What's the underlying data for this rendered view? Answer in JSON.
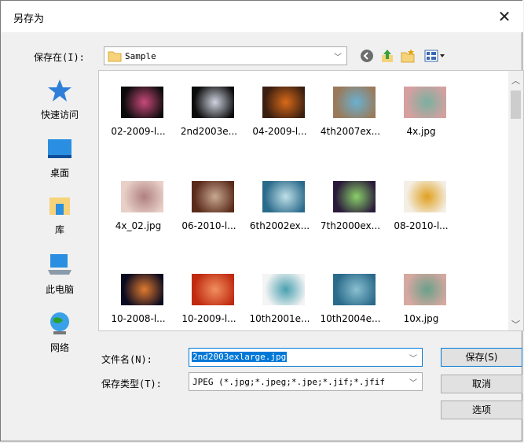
{
  "dialog": {
    "title": "另存为"
  },
  "toolbar": {
    "save_in_label": "保存在(I):",
    "current_folder": "Sample"
  },
  "places": [
    {
      "label": "快速访问",
      "icon": "star-icon"
    },
    {
      "label": "桌面",
      "icon": "desktop-icon"
    },
    {
      "label": "库",
      "icon": "library-icon"
    },
    {
      "label": "此电脑",
      "icon": "computer-icon"
    },
    {
      "label": "网络",
      "icon": "network-icon"
    }
  ],
  "files": [
    {
      "name": "02-2009-l...",
      "colors": [
        "#0b0b0b",
        "#c84a7a"
      ]
    },
    {
      "name": "2nd2003e...",
      "colors": [
        "#0b0b0b",
        "#cfd3e0"
      ]
    },
    {
      "name": "04-2009-l...",
      "colors": [
        "#3a1e10",
        "#d86a1a"
      ]
    },
    {
      "name": "4th2007ex...",
      "colors": [
        "#9a7a5a",
        "#6ab0d0"
      ]
    },
    {
      "name": "4x.jpg",
      "colors": [
        "#d6a0a0",
        "#7ab0a0"
      ]
    },
    {
      "name": "4x_02.jpg",
      "colors": [
        "#e8d0c8",
        "#b08080"
      ]
    },
    {
      "name": "06-2010-l...",
      "colors": [
        "#5a2a1a",
        "#c8a890"
      ]
    },
    {
      "name": "6th2002ex...",
      "colors": [
        "#2a6a8a",
        "#bfe0e8"
      ]
    },
    {
      "name": "7th2000ex...",
      "colors": [
        "#2a1a3a",
        "#8acf6a"
      ]
    },
    {
      "name": "08-2010-l...",
      "colors": [
        "#f4efe6",
        "#e0a020"
      ]
    },
    {
      "name": "10-2008-l...",
      "colors": [
        "#0a0a20",
        "#e07a30"
      ]
    },
    {
      "name": "10-2009-l...",
      "colors": [
        "#c02a10",
        "#f09060"
      ]
    },
    {
      "name": "10th2001e...",
      "colors": [
        "#f4f4f4",
        "#4aa0b0"
      ]
    },
    {
      "name": "10th2004e...",
      "colors": [
        "#2a6a8a",
        "#8ac0d0"
      ]
    },
    {
      "name": "10x.jpg",
      "colors": [
        "#d6a8a0",
        "#6aa08a"
      ]
    }
  ],
  "fields": {
    "filename_label": "文件名(N):",
    "filename_value": "2nd2003exlarge.jpg",
    "filetype_label": "保存类型(T):",
    "filetype_value": "JPEG (*.jpg;*.jpeg;*.jpe;*.jif;*.jfif"
  },
  "buttons": {
    "save": "保存(S)",
    "cancel": "取消",
    "options": "选项"
  }
}
